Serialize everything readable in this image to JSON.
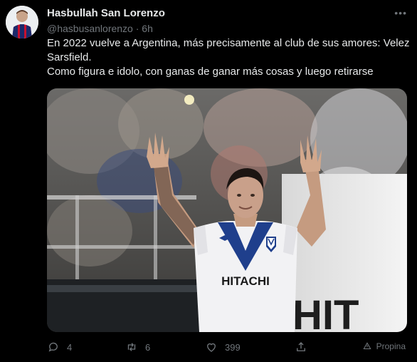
{
  "tweet": {
    "author_name": "Hasbullah San Lorenzo",
    "handle_time": "@hasbusanlorenzo · 6h",
    "more_icon": "more-dots-icon",
    "text_line1": "En 2022 vuelve a Argentina, más precisamente al club de sus amores: Velez Sarsfield.",
    "text_line2": "Como figura e idolo, con ganas de ganar más cosas y luego retirarse",
    "media": {
      "jersey_text": "HITACHI",
      "banner_text": "HIT"
    },
    "actions": {
      "reply_count": "4",
      "retweet_count": "6",
      "like_count": "399",
      "promo_label": "Propina"
    }
  },
  "colors": {
    "background": "#000000",
    "text_primary": "#e7e9ea",
    "text_secondary": "#71767b",
    "jersey_blue": "#1f3f8c"
  }
}
